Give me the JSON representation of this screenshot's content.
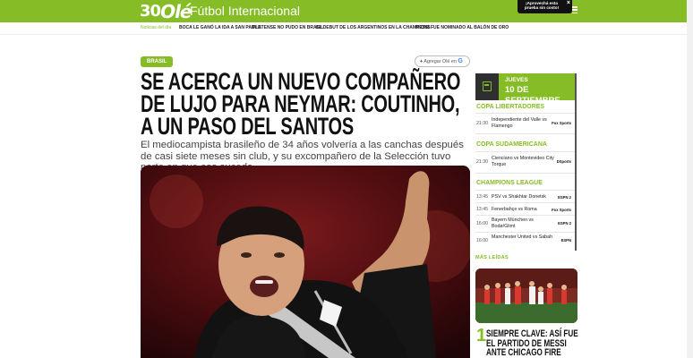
{
  "header": {
    "logo_30": "30",
    "logo_ole": "Olé",
    "section_title": "Fútbol Internacional",
    "promo_text": "¡Aprovechá esta prueba sin costo!",
    "promo_close": "×"
  },
  "subnav": {
    "items": [
      "Noticias del día",
      "BOCA LE GANÓ LA IDA A SAN PABLO",
      "PLATENSE NO PUDO EN BRASIL",
      "EL DEBUT DE LOS ARGENTINOS EN LA CHAMPIONS",
      "MESSI FUE NOMINADO AL BALÓN DE ORO"
    ]
  },
  "article": {
    "tag": "BRASIL",
    "follow_label": "Agregar Olé en",
    "follow_g": "G",
    "headline": "SE ACERCA UN NUEVO COMPAÑERO DE LUJO PARA NEYMAR: COUTINHO, A UN PASO DEL SANTOS",
    "subtitle": "El mediocampista brasileño de 34 años volvería a las canchas después de casi siete meses sin club, y su excompañero de la Selección tuvo parte en que eso suceda."
  },
  "scoreboard": {
    "day": "JUEVES",
    "date": "10 DE SEPTIEMBRE",
    "competitions": [
      {
        "name": "COPA LIBERTADORES",
        "matches": [
          {
            "time": "21:30",
            "teams": "Independiente del Valle vs Flamengo",
            "tv": "Fox Sports"
          }
        ]
      },
      {
        "name": "COPA SUDAMERICANA",
        "matches": [
          {
            "time": "21:30",
            "teams": "Cienciano vs Montevideo City Torque",
            "tv": "DSports"
          }
        ]
      },
      {
        "name": "CHAMPIONS LEAGUE",
        "matches": [
          {
            "time": "13:45",
            "teams": "PSV vs Shakhtar Donetsk",
            "tv": "ESPN 2"
          },
          {
            "time": "13:45",
            "teams": "Fenerbahçe vs Roma",
            "tv": "Fox Sports"
          },
          {
            "time": "16:00",
            "teams": "Bayern München vs Bodø/Glimt",
            "tv": "ESPN 2"
          },
          {
            "time": "16:00",
            "teams": "Manchester United vs Sabah",
            "tv": "ESPN"
          }
        ]
      }
    ]
  },
  "mas_leidas": {
    "label": "MÁS LEÍDAS",
    "items": [
      {
        "number": "1",
        "title": "SIEMPRE CLAVE: ASÍ FUE EL PARTIDO DE MESSI ANTE CHICAGO FIRE"
      }
    ]
  },
  "colors": {
    "brand_green": "#86bc25",
    "dark": "#2f2f2f"
  }
}
